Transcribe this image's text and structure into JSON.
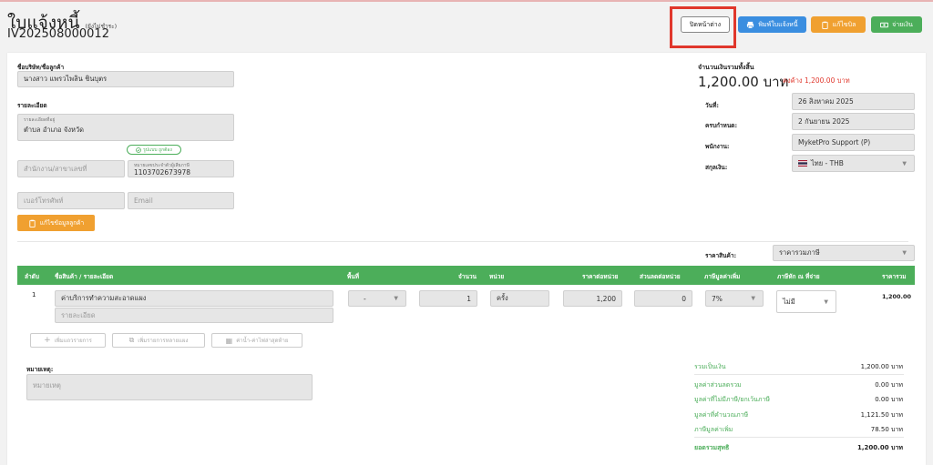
{
  "header": {
    "title": "ใบแจ้งหนี้",
    "status": "(ยังไม่ชำระ)",
    "doc_number": "IV202508000012",
    "buttons": {
      "close": "ปิดหน้าต่าง",
      "print": "พิมพ์ใบแจ้งหนี้",
      "edit": "แก้ไขบิล",
      "pay": "จ่ายเงิน"
    }
  },
  "customer": {
    "name_label": "ชื่อบริษัท/ชื่อลูกค้า",
    "name_value": "นางสาว แพรวไพลิน ชินบุตร",
    "details_label": "รายละเอียด",
    "address_small_label": "รายละเอียดที่อยู่",
    "address_value": "ตำบล อำเภอ จังหวัด",
    "verified_badge": "รูปแบบ ถูกต้อง",
    "branch_placeholder": "สำนักงาน/สาขาเลขที่",
    "taxid_small_label": "หมายเลขประจำตัวผู้เสียภาษี",
    "taxid_value": "1103702673978",
    "phone_placeholder": "เบอร์โทรศัพท์",
    "email_placeholder": "Email",
    "edit_button": "แก้ไขข้อมูลลูกค้า"
  },
  "summary_top": {
    "total_label": "จำนวนเงินรวมทั้งสิ้น",
    "total_amount": "1,200.00 บาท",
    "outstanding": "คงค้าง 1,200.00 บาท",
    "date_label": "วันที่:",
    "date_value": "26 สิงหาคม 2025",
    "due_label": "ครบกำหนด:",
    "due_value": "2 กันยายน 2025",
    "staff_label": "พนักงาน:",
    "staff_value": "MyketPro Support (P)",
    "currency_label": "สกุลเงิน:",
    "currency_value": "ไทย - THB",
    "price_type_label": "ราคาสินค้า:",
    "price_type_value": "ราคารวมภาษี"
  },
  "table": {
    "headers": [
      "ลำดับ",
      "ชื่อสินค้า / รายละเอียด",
      "พื้นที่",
      "จำนวน",
      "หน่วย",
      "ราคาต่อหน่วย",
      "ส่วนลดต่อหน่วย",
      "ภาษีมูลค่าเพิ่ม",
      "ภาษีหัก ณ ที่จ่าย",
      "ราคารวม"
    ],
    "row": {
      "index": "1",
      "product": "ค่าบริการทำความสะอาดแผง",
      "detail_placeholder": "รายละเอียด",
      "area": "-",
      "qty": "1",
      "unit": "ครั้ง",
      "unit_price": "1,200",
      "discount": "0",
      "vat": "7%",
      "wht": "ไม่มี",
      "total": "1,200.00"
    },
    "actions": {
      "add_row": "เพิ่มแถวรายการ",
      "add_multi": "เพิ่มรายการหลายแผง",
      "recent": "ค่าน้ำ-ค่าไฟล่าสุดท้าย"
    }
  },
  "notes": {
    "label": "หมายเหตุ:",
    "placeholder": "หมายเหตุ"
  },
  "totals": {
    "sum_label": "รวมเป็นเงิน",
    "sum_value": "1,200.00 บาท",
    "discount_label": "มูลค่าส่วนลดรวม",
    "discount_value": "0.00 บาท",
    "exempt_label": "มูลค่าที่ไม่มีภาษี/ยกเว้นภาษี",
    "exempt_value": "0.00 บาท",
    "taxable_label": "มูลค่าที่คำนวณภาษี",
    "taxable_value": "1,121.50 บาท",
    "vat_label": "ภาษีมูลค่าเพิ่ม",
    "vat_value": "78.50 บาท",
    "net_label": "ยอดรวมสุทธิ",
    "net_value": "1,200.00 บาท"
  },
  "colors": {
    "green": "#4cae5a",
    "blue": "#3a8ee0",
    "orange": "#f0a030",
    "red": "#e0372c"
  }
}
